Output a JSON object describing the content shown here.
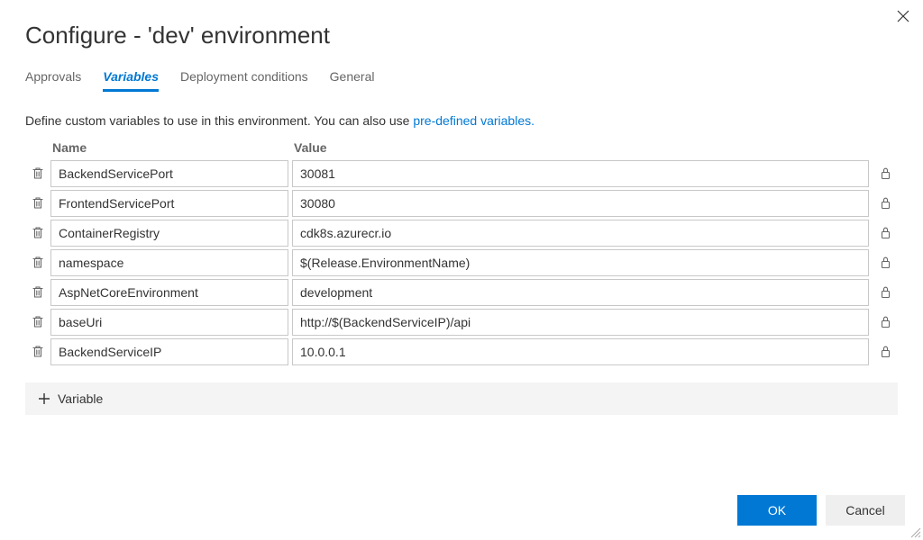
{
  "title": "Configure - 'dev' environment",
  "tabs": [
    {
      "label": "Approvals"
    },
    {
      "label": "Variables"
    },
    {
      "label": "Deployment conditions"
    },
    {
      "label": "General"
    }
  ],
  "description_pre": "Define custom variables to use in this environment. You can also use ",
  "description_link": "pre-defined variables.",
  "headers": {
    "name": "Name",
    "value": "Value"
  },
  "variables": [
    {
      "name": "BackendServicePort",
      "value": "30081"
    },
    {
      "name": "FrontendServicePort",
      "value": "30080"
    },
    {
      "name": "ContainerRegistry",
      "value": "cdk8s.azurecr.io"
    },
    {
      "name": "namespace",
      "value": "$(Release.EnvironmentName)"
    },
    {
      "name": "AspNetCoreEnvironment",
      "value": "development"
    },
    {
      "name": "baseUri",
      "value": "http://$(BackendServiceIP)/api"
    },
    {
      "name": "BackendServiceIP",
      "value": "10.0.0.1"
    }
  ],
  "add_variable_label": "Variable",
  "buttons": {
    "ok": "OK",
    "cancel": "Cancel"
  }
}
